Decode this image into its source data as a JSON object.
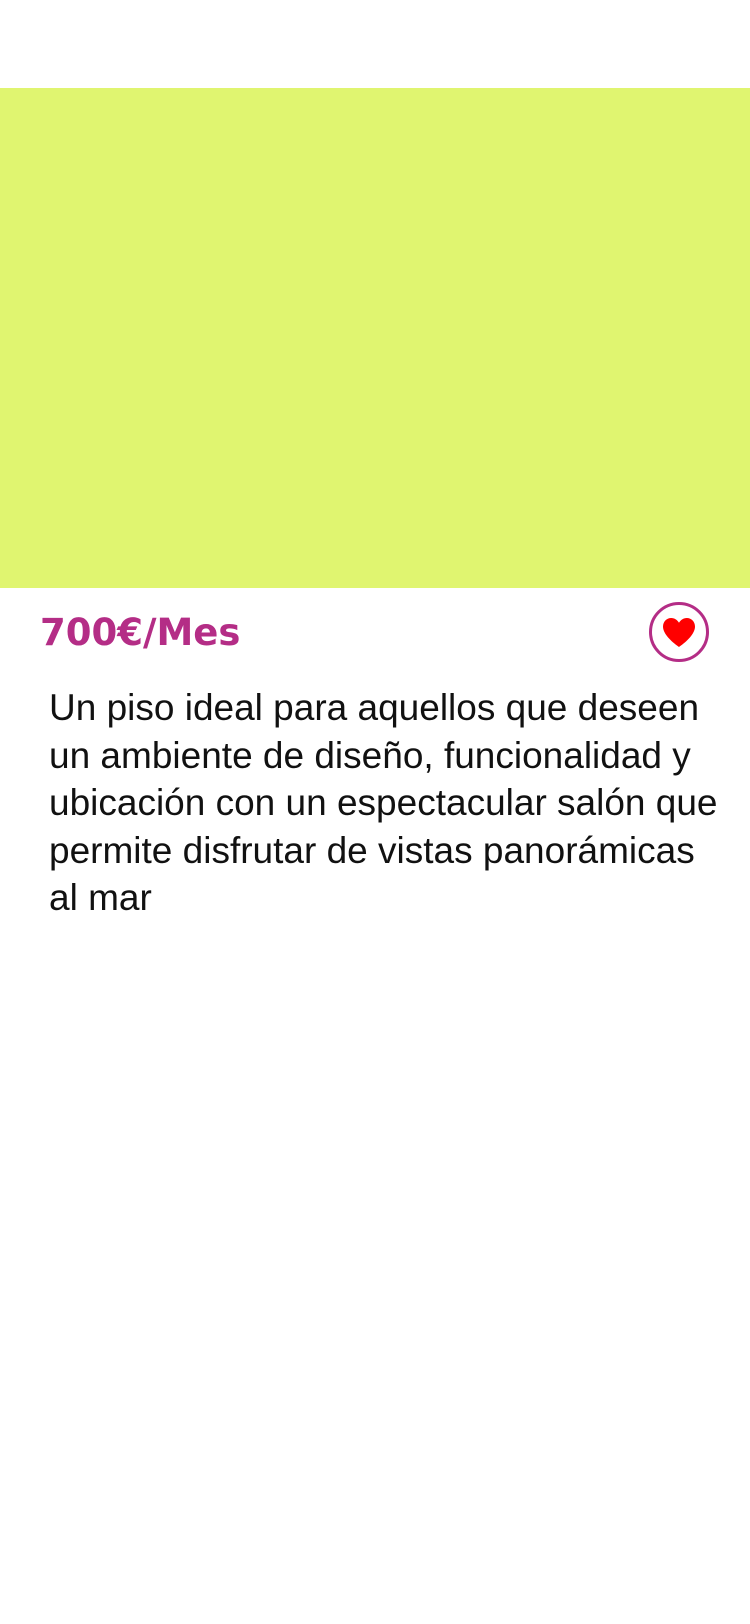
{
  "listing": {
    "image_color": "#e0f570",
    "price": "700€/Mes",
    "description": "Un piso ideal para aquellos que deseen un ambiente de diseño, funcionalidad y ubicación con un espectacular salón que permite disfrutar de vistas panorámicas al mar",
    "favorite_icon": "heart-icon"
  },
  "colors": {
    "accent": "#b42d86",
    "heart": "#ff0000",
    "text": "#111111"
  }
}
